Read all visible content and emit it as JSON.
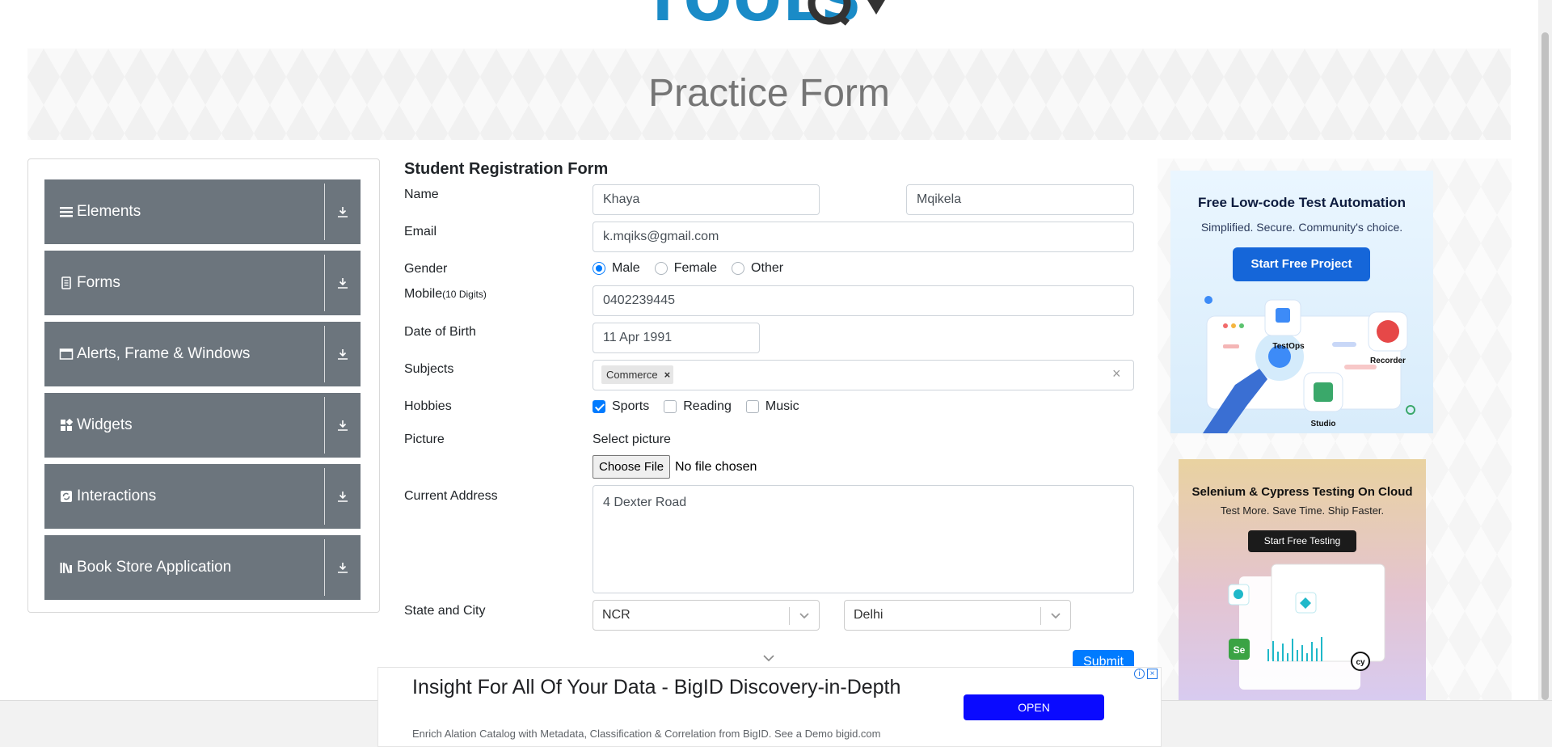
{
  "header": {
    "logo_text": "TOOLS",
    "logo_suffix": "QA",
    "page_title": "Practice Form"
  },
  "sidebar": {
    "groups": [
      {
        "label": "Elements",
        "icon": "hamburger-icon"
      },
      {
        "label": "Forms",
        "icon": "document-icon"
      },
      {
        "label": "Alerts, Frame & Windows",
        "icon": "window-icon"
      },
      {
        "label": "Widgets",
        "icon": "grid-icon"
      },
      {
        "label": "Interactions",
        "icon": "cycle-icon"
      },
      {
        "label": "Book Store Application",
        "icon": "books-icon"
      }
    ]
  },
  "form": {
    "title": "Student Registration Form",
    "name_label": "Name",
    "first_name": "Khaya",
    "last_name": "Mqikela",
    "email_label": "Email",
    "email": "k.mqiks@gmail.com",
    "gender_label": "Gender",
    "gender_options": [
      "Male",
      "Female",
      "Other"
    ],
    "gender_selected": "Male",
    "mobile_label": "Mobile",
    "mobile_hint": "(10 Digits)",
    "mobile": "0402239445",
    "dob_label": "Date of Birth",
    "dob": "11 Apr 1991",
    "subjects_label": "Subjects",
    "subjects": [
      "Commerce"
    ],
    "hobbies_label": "Hobbies",
    "hobbies": [
      {
        "label": "Sports",
        "checked": true
      },
      {
        "label": "Reading",
        "checked": false
      },
      {
        "label": "Music",
        "checked": false
      }
    ],
    "picture_label": "Picture",
    "picture_prompt": "Select picture",
    "file_button": "Choose File",
    "file_status": "No file chosen",
    "address_label": "Current Address",
    "address": "4 Dexter Road",
    "state_city_label": "State and City",
    "state": "NCR",
    "city": "Delhi",
    "submit_label": "Submit"
  },
  "ads": {
    "ad1": {
      "title": "Free Low-code Test Automation",
      "subtitle": "Simplified. Secure. Community's choice.",
      "button": "Start Free Project",
      "labels": [
        "TestOps",
        "Recorder",
        "Studio"
      ]
    },
    "ad2": {
      "title": "Selenium & Cypress Testing On Cloud",
      "subtitle": "Test More. Save Time. Ship Faster.",
      "button": "Start Free Testing"
    },
    "bottom": {
      "title": "Insight For All Of Your Data - BigID Discovery-in-Depth",
      "description": "Enrich Alation Catalog with Metadata, Classification & Correlation from BigID. See a Demo bigid.com",
      "button": "OPEN"
    }
  },
  "colors": {
    "accent": "#007bff",
    "sidebar_group": "#6c757d",
    "logo": "#1a8bc7"
  }
}
